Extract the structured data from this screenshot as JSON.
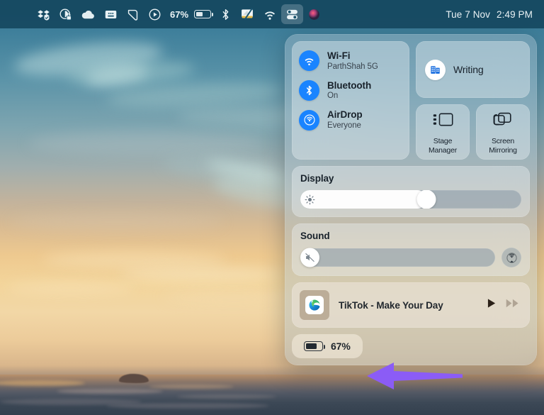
{
  "menubar": {
    "left_icons": [
      {
        "name": "dropbox-icon",
        "glyph": "dropbox"
      },
      {
        "name": "privacy-lock-icon",
        "glyph": "lock-circle"
      },
      {
        "name": "cloud-icon",
        "glyph": "cloud"
      },
      {
        "name": "keyboard-icon",
        "glyph": "keyboard"
      },
      {
        "name": "shortcut-icon",
        "glyph": "shortcut"
      },
      {
        "name": "play-circle-icon",
        "glyph": "play-circle"
      }
    ],
    "battery_percent": "67%",
    "right_icons": [
      {
        "name": "bluetooth-icon",
        "glyph": "bluetooth"
      },
      {
        "name": "screenshot-icon",
        "glyph": "screenshot"
      },
      {
        "name": "wifi-icon",
        "glyph": "wifi"
      },
      {
        "name": "control-center-icon",
        "glyph": "control-center"
      },
      {
        "name": "siri-icon",
        "glyph": "siri"
      }
    ],
    "clock_date": "Tue 7 Nov",
    "clock_time": "2:49 PM"
  },
  "control_center": {
    "connectivity": [
      {
        "icon": "wifi-icon",
        "title": "Wi-Fi",
        "subtitle": "ParthShah 5G"
      },
      {
        "icon": "bluetooth-icon",
        "title": "Bluetooth",
        "subtitle": "On"
      },
      {
        "icon": "airdrop-icon",
        "title": "AirDrop",
        "subtitle": "Everyone"
      }
    ],
    "focus": {
      "icon": "office-building-icon",
      "label": "Writing"
    },
    "tiles": [
      {
        "icon": "stage-manager-icon",
        "label": "Stage\nManager",
        "line1": "Stage",
        "line2": "Manager"
      },
      {
        "icon": "screen-mirroring-icon",
        "label": "Screen\nMirroring",
        "line1": "Screen",
        "line2": "Mirroring"
      }
    ],
    "display": {
      "title": "Display",
      "icon": "brightness-icon",
      "value_percent": 57
    },
    "sound": {
      "title": "Sound",
      "icon": "mute-icon",
      "value_percent": 0,
      "output_icon": "airplay-audio-icon"
    },
    "media": {
      "title": "TikTok - Make Your Day",
      "app_icon": "edge-icon",
      "play_icon": "play-icon",
      "next_icon": "fast-forward-icon"
    },
    "battery": {
      "percent": "67%",
      "icon": "battery-icon",
      "level": 67
    }
  },
  "annotation": {
    "arrow_color": "#8b5cf6",
    "points_to": "battery-module"
  }
}
